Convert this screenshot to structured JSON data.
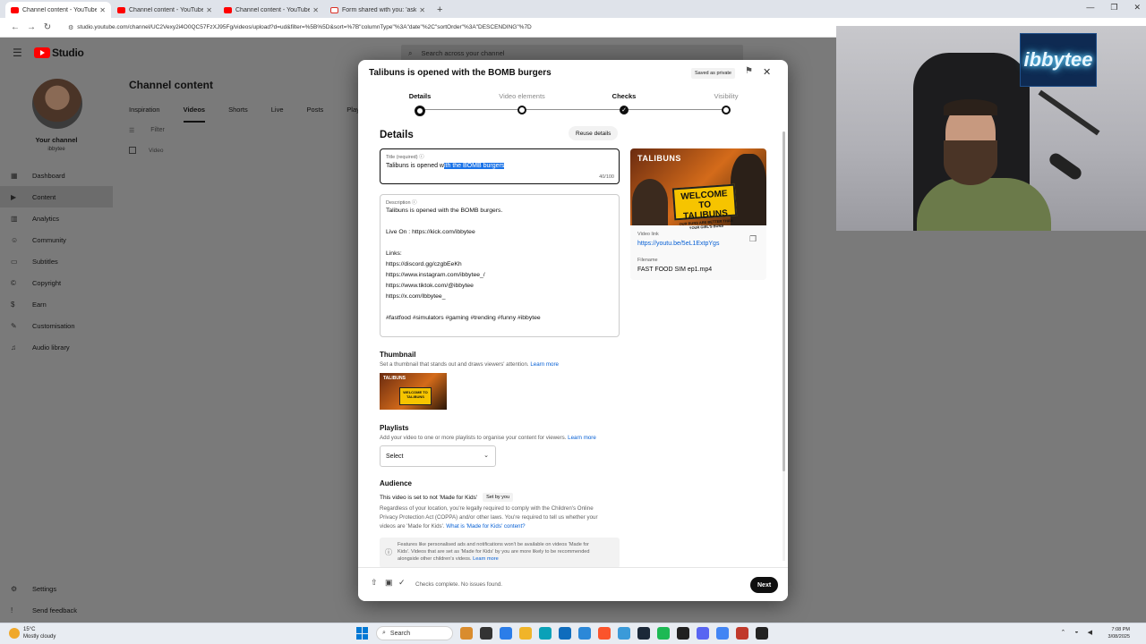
{
  "browser": {
    "tabs": [
      {
        "label": "Channel content - YouTube Stu",
        "active": true,
        "favicon": "youtube-icon"
      },
      {
        "label": "Channel content - YouTube Stu",
        "active": false,
        "favicon": "youtube-icon"
      },
      {
        "label": "Channel content - YouTube Stu",
        "active": false,
        "favicon": "youtube-icon"
      },
      {
        "label": "Form shared with you: 'ask us a",
        "active": false,
        "favicon": "gmail-icon"
      }
    ],
    "new_tab": "+",
    "url": "studio.youtube.com/channel/UC2Vexy2i4O0QC57FzXJ95Fg/videos/upload?d=ud&filter=%5B%5D&sort=%7B\"columnType\"%3A\"date\"%2C\"sortOrder\"%3A\"DESCENDING\"%7D"
  },
  "studio": {
    "logo_text": "Studio",
    "search_placeholder": "Search across your channel",
    "channel": {
      "label": "Your channel",
      "handle": "ibbytee"
    },
    "nav": [
      {
        "label": "Dashboard",
        "icon": "dashboard-icon",
        "glyph": "▦"
      },
      {
        "label": "Content",
        "icon": "content-icon",
        "glyph": "▶",
        "active": true
      },
      {
        "label": "Analytics",
        "icon": "analytics-icon",
        "glyph": "▥"
      },
      {
        "label": "Community",
        "icon": "community-icon",
        "glyph": "☺"
      },
      {
        "label": "Subtitles",
        "icon": "subtitles-icon",
        "glyph": "▭"
      },
      {
        "label": "Copyright",
        "icon": "copyright-icon",
        "glyph": "©"
      },
      {
        "label": "Earn",
        "icon": "earn-icon",
        "glyph": "$"
      },
      {
        "label": "Customisation",
        "icon": "customisation-icon",
        "glyph": "✎"
      },
      {
        "label": "Audio library",
        "icon": "audio-library-icon",
        "glyph": "♫"
      }
    ],
    "nav_bottom": [
      {
        "label": "Settings",
        "icon": "settings-icon",
        "glyph": "⚙"
      },
      {
        "label": "Send feedback",
        "icon": "feedback-icon",
        "glyph": "!"
      }
    ],
    "page_title": "Channel content",
    "tabs": [
      "Inspiration",
      "Videos",
      "Shorts",
      "Live",
      "Posts",
      "Playlists"
    ],
    "active_tab": "Videos",
    "filter_label": "Filter",
    "list_header": "Video"
  },
  "modal": {
    "title": "Talibuns is opened with the BOMB burgers",
    "saved_badge": "Saved as private",
    "steps": [
      {
        "label": "Details",
        "state": "current"
      },
      {
        "label": "Video elements",
        "state": "pending"
      },
      {
        "label": "Checks",
        "state": "done"
      },
      {
        "label": "Visibility",
        "state": "pending"
      }
    ],
    "details_heading": "Details",
    "reuse_button": "Reuse details",
    "title_field": {
      "label": "Title (required)",
      "value_before": "Talibuns is opened w",
      "value_selected": "ith the BOMB burgers",
      "counter": "40/100"
    },
    "description_field": {
      "label": "Description",
      "lines": [
        "Talibuns is opened with the BOMB burgers.",
        "",
        "Live On  : https://kick.com/ibbytee",
        "",
        "Links:",
        "https://discord.gg/czgbEeKh",
        "https://www.instagram.com/ibbytee_/",
        "https://www.tiktok.com/@ibbytee",
        "https://x.com/Ibbytee_",
        "",
        "#fastfood #simulators #gaming #trending #funny #ibbytee"
      ]
    },
    "preview": {
      "thumb_text": "TALIBUNS",
      "sign_big": "WELCOME TO TALIBUNS",
      "sign_small": "OUR BUNS ARE BETTER THAN YOUR GIRL'S BUNS",
      "video_link_label": "Video link",
      "video_link": "https://youtu.be/5eL1ExtpYgs",
      "filename_label": "Filename",
      "filename": "FAST FOOD SIM ep1.mp4"
    },
    "thumbnail": {
      "heading": "Thumbnail",
      "desc": "Set a thumbnail that stands out and draws viewers' attention.",
      "learn_more": "Learn more"
    },
    "playlists": {
      "heading": "Playlists",
      "desc": "Add your video to one or more playlists to organise your content for viewers.",
      "learn_more": "Learn more",
      "select_value": "Select"
    },
    "audience": {
      "heading": "Audience",
      "status": "This video is set to not 'Made for Kids'",
      "set_by": "Set by you",
      "para_lines": [
        "Regardless of your location, you're legally required to comply with the Children's Online",
        "Privacy Protection Act (COPPA) and/or other laws. You're required to tell us whether your",
        "videos are 'Made for Kids'."
      ],
      "para_link": "What is 'Made for Kids' content?",
      "info_lines": [
        "Features like personalised ads and notifications won't be available on videos 'Made for",
        "Kids'. Videos that are set as 'Made for Kids' by you are more likely to be recommended",
        "alongside other children's videos."
      ],
      "info_link": "Learn more"
    },
    "footer": {
      "status": "Checks complete. No issues found.",
      "next_button": "Next"
    }
  },
  "webcam": {
    "neon_sign": "ibbytee"
  },
  "taskbar": {
    "weather_temp": "15°C",
    "weather_desc": "Mostly cloudy",
    "search_label": "Search",
    "clock_time": "7:08 PM",
    "clock_date": "3/08/2025",
    "app_colors": [
      "#d98c2e",
      "#333333",
      "#2b7de9",
      "#f0b429",
      "#0aa1b8",
      "#0f6cbd",
      "#2b88d8",
      "#fb542b",
      "#3a9ad9",
      "#1b2838",
      "#1db954",
      "#202020",
      "#5865f2",
      "#4285f4",
      "#c0392b",
      "#222222"
    ]
  }
}
